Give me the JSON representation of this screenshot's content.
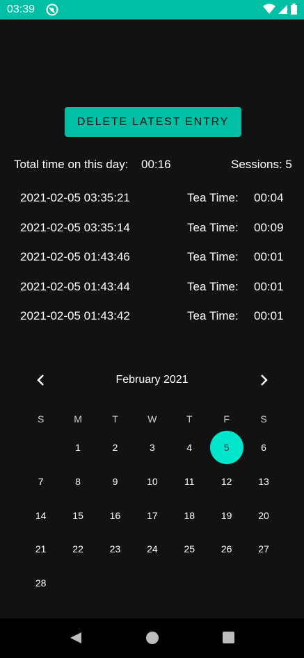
{
  "status_bar": {
    "time": "03:39"
  },
  "actions": {
    "delete_label": "DELETE LATEST ENTRY"
  },
  "summary": {
    "total_label": "Total time on this day:",
    "total_value": "00:16",
    "sessions_label": "Sessions: 5"
  },
  "entries": [
    {
      "timestamp": "2021-02-05 03:35:21",
      "tea_label": "Tea Time:",
      "tea_value": "00:04"
    },
    {
      "timestamp": "2021-02-05 03:35:14",
      "tea_label": "Tea Time:",
      "tea_value": "00:09"
    },
    {
      "timestamp": "2021-02-05 01:43:46",
      "tea_label": "Tea Time:",
      "tea_value": "00:01"
    },
    {
      "timestamp": "2021-02-05 01:43:44",
      "tea_label": "Tea Time:",
      "tea_value": "00:01"
    },
    {
      "timestamp": "2021-02-05 01:43:42",
      "tea_label": "Tea Time:",
      "tea_value": "00:01"
    }
  ],
  "calendar": {
    "month_label": "February 2021",
    "weekdays": [
      "S",
      "M",
      "T",
      "W",
      "T",
      "F",
      "S"
    ],
    "weeks": [
      [
        "",
        "1",
        "2",
        "3",
        "4",
        "5",
        "6"
      ],
      [
        "7",
        "8",
        "9",
        "10",
        "11",
        "12",
        "13"
      ],
      [
        "14",
        "15",
        "16",
        "17",
        "18",
        "19",
        "20"
      ],
      [
        "21",
        "22",
        "23",
        "24",
        "25",
        "26",
        "27"
      ],
      [
        "28",
        "",
        "",
        "",
        "",
        "",
        ""
      ]
    ],
    "selected_day": "5",
    "accent_color": "#00E5CC"
  },
  "theme": {
    "brand": "#00BFA5",
    "background": "#121212"
  }
}
